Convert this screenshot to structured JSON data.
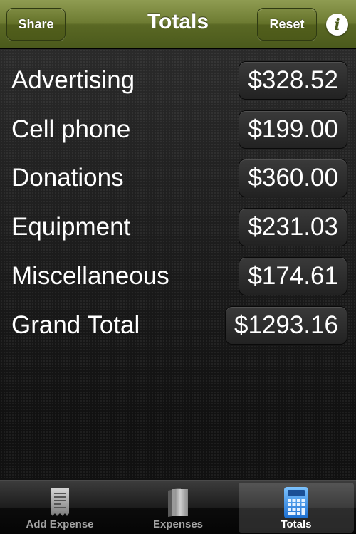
{
  "navbar": {
    "title": "Totals",
    "share_label": "Share",
    "reset_label": "Reset",
    "info_glyph": "i"
  },
  "totals": [
    {
      "label": "Advertising",
      "value": "$328.52"
    },
    {
      "label": "Cell phone",
      "value": "$199.00"
    },
    {
      "label": "Donations",
      "value": "$360.00"
    },
    {
      "label": "Equipment",
      "value": "$231.03"
    },
    {
      "label": "Miscellaneous",
      "value": "$174.61"
    }
  ],
  "grand_total": {
    "label": "Grand Total",
    "value": "$1293.16"
  },
  "tabbar": {
    "tabs": [
      {
        "label": "Add Expense",
        "icon": "receipt-icon",
        "selected": false
      },
      {
        "label": "Expenses",
        "icon": "book-icon",
        "selected": false
      },
      {
        "label": "Totals",
        "icon": "calculator-icon",
        "selected": true
      }
    ]
  },
  "colors": {
    "navbar": "#6d7b32",
    "selected_tab_icon": "#2f8fe0"
  }
}
